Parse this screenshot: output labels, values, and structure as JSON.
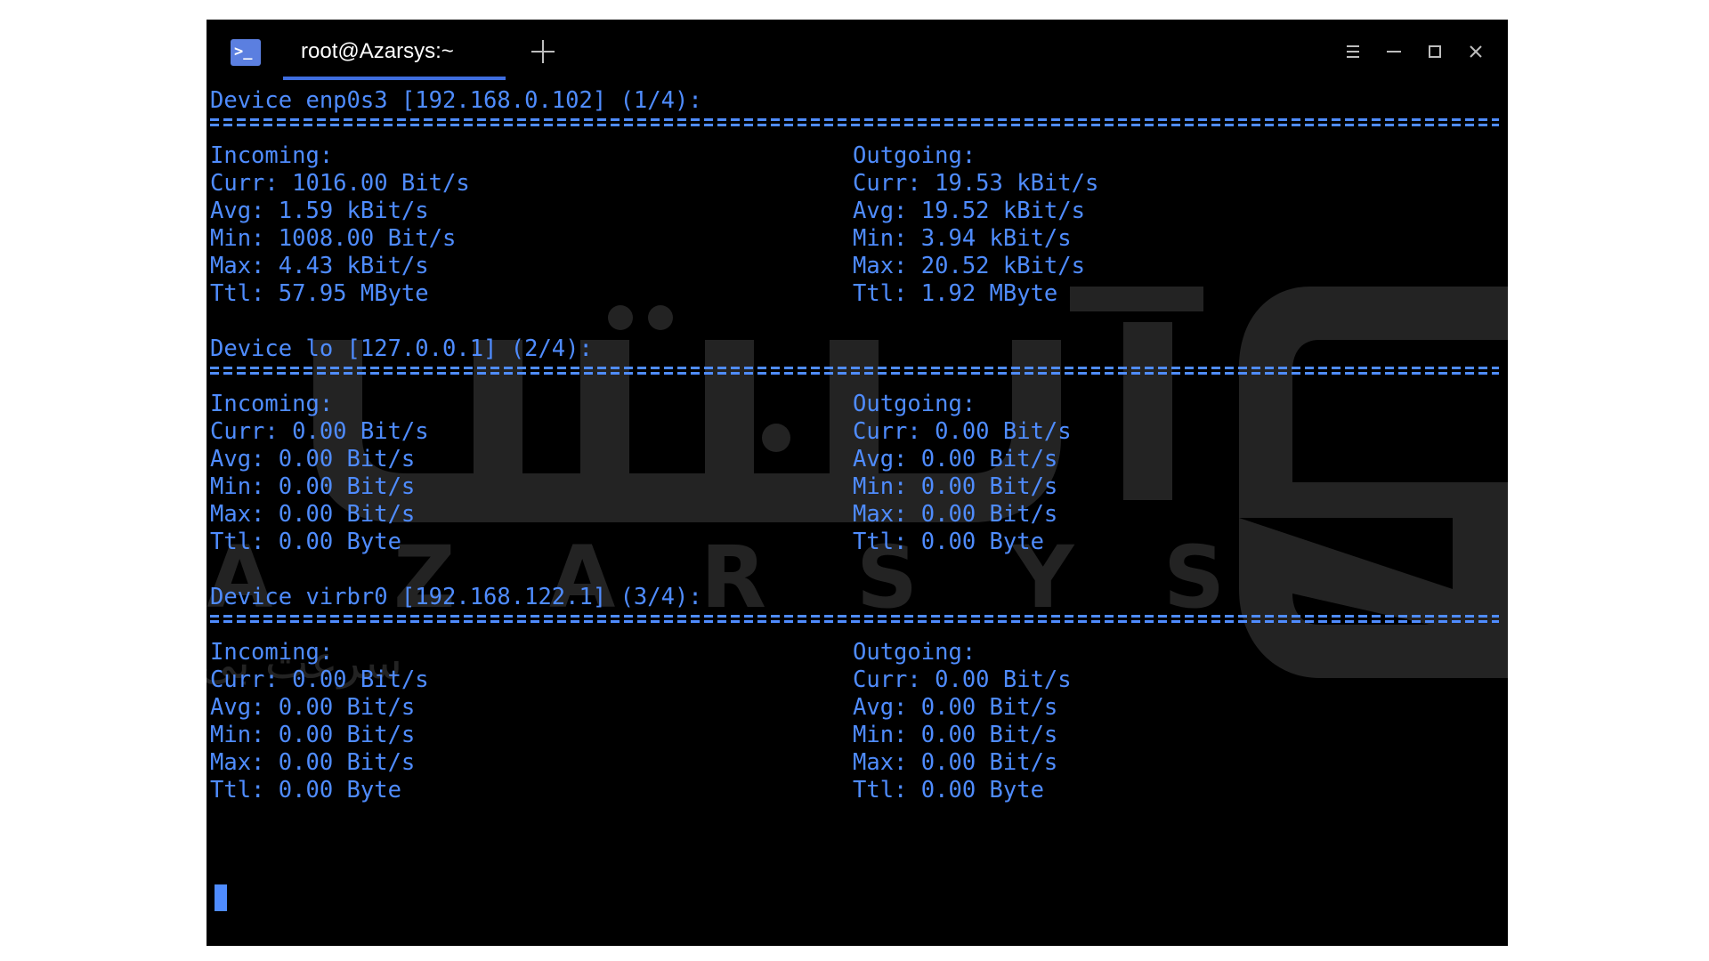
{
  "window": {
    "tab_title": "root@Azarsys:~",
    "app_icon_glyph": ">_"
  },
  "icons": {
    "app": "terminal-icon",
    "new_tab": "plus-icon",
    "menu": "hamburger-menu-icon",
    "minimize": "minimize-icon",
    "maximize": "maximize-icon",
    "close": "close-icon"
  },
  "colors": {
    "terminal_text": "#4f8cff",
    "tab_accent": "#3f6ee0",
    "background": "#000000"
  },
  "devices": [
    {
      "header": "Device enp0s3 [192.168.0.102] (1/4):",
      "incoming": {
        "label": "Incoming:",
        "curr": "Curr: 1016.00 Bit/s",
        "avg": "Avg: 1.59 kBit/s",
        "min": "Min: 1008.00 Bit/s",
        "max": "Max: 4.43 kBit/s",
        "ttl": "Ttl: 57.95 MByte"
      },
      "outgoing": {
        "label": "Outgoing:",
        "curr": "Curr: 19.53 kBit/s",
        "avg": "Avg: 19.52 kBit/s",
        "min": "Min: 3.94 kBit/s",
        "max": "Max: 20.52 kBit/s",
        "ttl": "Ttl: 1.92 MByte"
      }
    },
    {
      "header": "Device lo [127.0.0.1] (2/4):",
      "incoming": {
        "label": "Incoming:",
        "curr": "Curr: 0.00 Bit/s",
        "avg": "Avg: 0.00 Bit/s",
        "min": "Min: 0.00 Bit/s",
        "max": "Max: 0.00 Bit/s",
        "ttl": "Ttl: 0.00 Byte"
      },
      "outgoing": {
        "label": "Outgoing:",
        "curr": "Curr: 0.00 Bit/s",
        "avg": "Avg: 0.00 Bit/s",
        "min": "Min: 0.00 Bit/s",
        "max": "Max: 0.00 Bit/s",
        "ttl": "Ttl: 0.00 Byte"
      }
    },
    {
      "header": "Device virbr0 [192.168.122.1] (3/4):",
      "incoming": {
        "label": "Incoming:",
        "curr": "Curr: 0.00 Bit/s",
        "avg": "Avg: 0.00 Bit/s",
        "min": "Min: 0.00 Bit/s",
        "max": "Max: 0.00 Bit/s",
        "ttl": "Ttl: 0.00 Byte"
      },
      "outgoing": {
        "label": "Outgoing:",
        "curr": "Curr: 0.00 Bit/s",
        "avg": "Avg: 0.00 Bit/s",
        "min": "Min: 0.00 Bit/s",
        "max": "Max: 0.00 Bit/s",
        "ttl": "Ttl: 0.00 Byte"
      }
    }
  ],
  "watermark": {
    "latin": "AZARSYS",
    "tagline": "سرعت بی نهایت میزبانی وب",
    "brand_fa": "آذرسیس"
  }
}
